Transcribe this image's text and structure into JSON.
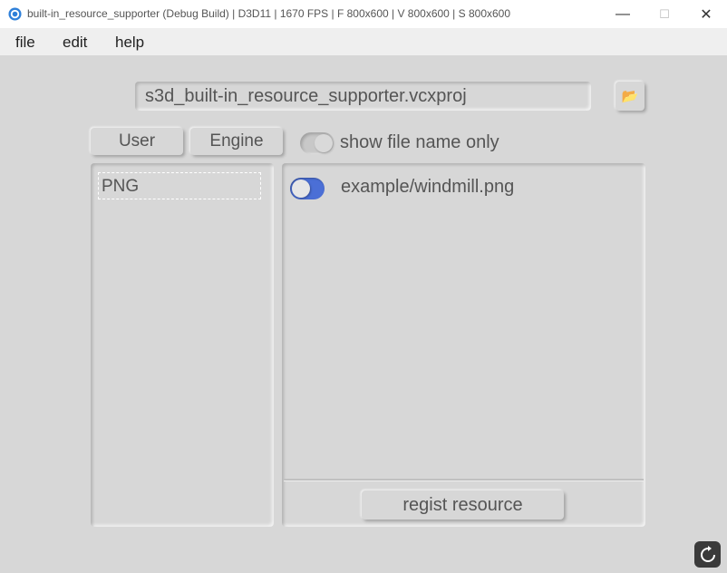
{
  "window": {
    "title": "built-in_resource_supporter (Debug Build) | D3D11 | 1670 FPS | F 800x600 | V 800x600 | S 800x600",
    "minimize": "—",
    "maximize": "☐",
    "close": "✕"
  },
  "menu": {
    "file": "file",
    "edit": "edit",
    "help": "help"
  },
  "project": {
    "path": "s3d_built-in_resource_supporter.vcxproj",
    "folder_icon": "📂"
  },
  "tabs": {
    "user": "User",
    "engine": "Engine"
  },
  "filter": {
    "show_file_name_only_label": "show file name only",
    "show_file_name_only": false
  },
  "categories": [
    {
      "label": "PNG",
      "selected": true
    }
  ],
  "resources": [
    {
      "label": "example/windmill.png",
      "enabled": true
    }
  ],
  "actions": {
    "regist_label": "regist resource"
  },
  "colors": {
    "background": "#d7d7d7",
    "accent": "#4b6fd6"
  }
}
